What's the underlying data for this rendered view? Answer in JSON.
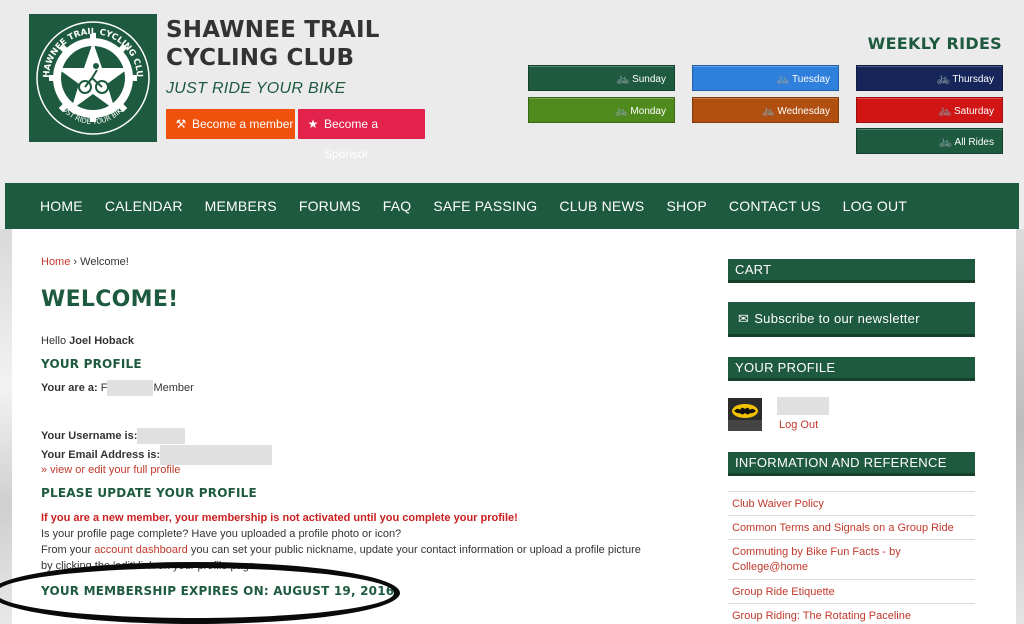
{
  "site": {
    "title": "SHAWNEE TRAIL CYCLING CLUB",
    "tagline": "JUST RIDE YOUR BIKE",
    "logo": {
      "top_text": "SHAWNEE TRAIL CYCLING CLUB",
      "bottom_text": "JUST RIDE YOUR BIKE"
    }
  },
  "cta": {
    "member": "Become a member",
    "sponsor": "Become a Sponsor"
  },
  "weekly": {
    "title": "WEEKLY RIDES",
    "rides": [
      {
        "label": "Sunday",
        "color": "#1e5a3f"
      },
      {
        "label": "Monday",
        "color": "#4e8a1c"
      },
      {
        "label": "Tuesday",
        "color": "#2f7fdc"
      },
      {
        "label": "Wednesday",
        "color": "#b04f0f"
      },
      {
        "label": "Thursday",
        "color": "#17265a"
      },
      {
        "label": "Saturday",
        "color": "#d11414"
      },
      {
        "label": "All Rides",
        "color": "#1e5a3f"
      }
    ]
  },
  "nav": [
    "HOME",
    "CALENDAR",
    "MEMBERS",
    "FORUMS",
    "FAQ",
    "SAFE PASSING",
    "CLUB NEWS",
    "SHOP",
    "CONTACT US",
    "LOG OUT"
  ],
  "breadcrumb": {
    "home": "Home",
    "sep": "›",
    "current": "Welcome!"
  },
  "main": {
    "title": "WELCOME!",
    "hello_prefix": "Hello",
    "user_name": "Joel Hoback",
    "profile_head": "YOUR PROFILE",
    "you_are_label": "Your are a:",
    "you_are_prefix": "F",
    "you_are_suffix": "Member",
    "username_label": "Your Username is:",
    "email_label": "Your Email Address is:",
    "edit_profile_link": "» view or edit your full profile",
    "update_head": "PLEASE UPDATE YOUR PROFILE",
    "warning": "If you are a new member, your membership is not activated until you complete your profile!",
    "question": "Is your profile page complete? Have you uploaded a profile photo or icon?",
    "from_prefix": "From your",
    "account_link": "account dashboard",
    "from_suffix": "you can set your public nickname, update your contact information or upload a profile picture",
    "by_clicking": "by clicking the 'edit' link on your profile page.",
    "expires": "YOUR MEMBERSHIP EXPIRES ON: AUGUST 19, 2016"
  },
  "sidebar": {
    "cart": "CART",
    "newsletter": "Subscribe to our newsletter",
    "profile_head": "YOUR PROFILE",
    "log_out": "Log Out",
    "info_head": "INFORMATION AND REFERENCE",
    "links": [
      "Club Waiver Policy",
      "Common Terms and Signals on a Group Ride",
      "Commuting by Bike Fun Facts - by College@home",
      "Group Ride Etiquette",
      "Group Riding: The Rotating Paceline"
    ]
  },
  "colors": {
    "brand_green": "#1e5a3f",
    "link_red": "#c0392b",
    "member_orange": "#f0520c",
    "sponsor_pink": "#e2224a"
  }
}
